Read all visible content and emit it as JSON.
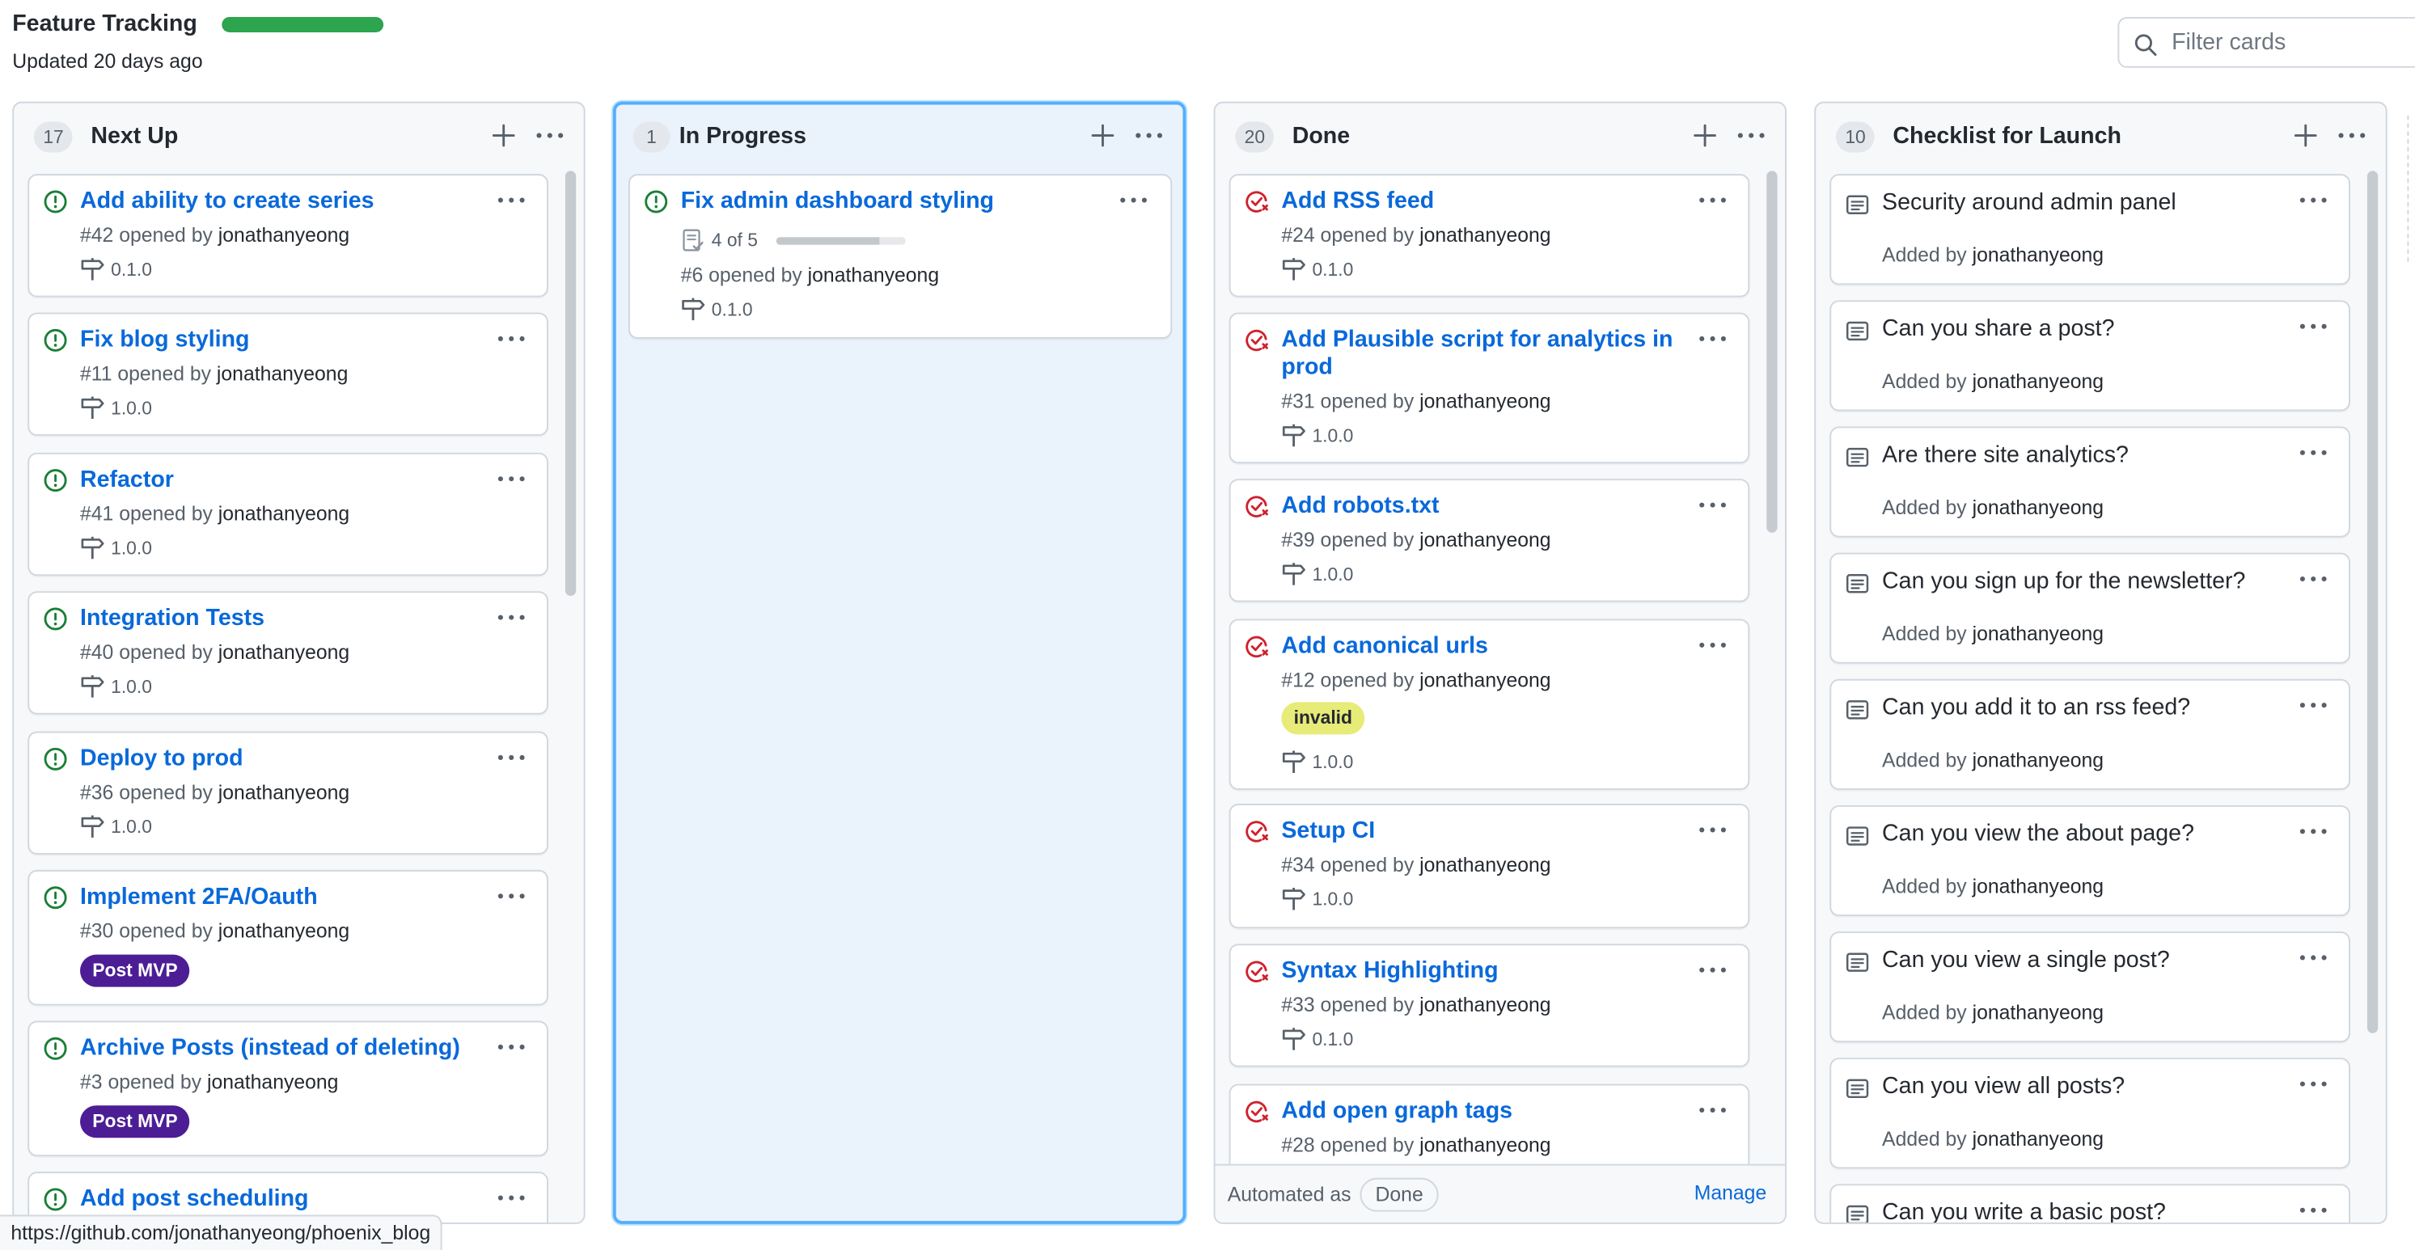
{
  "header": {
    "title": "Feature Tracking",
    "progress": 1.0,
    "updated": "Updated 20 days ago",
    "filter_placeholder": "Filter cards"
  },
  "colors": {
    "open_issue": "#1a7f37",
    "closed_issue": "#cf222e",
    "link": "#0969da",
    "progress": "#2da44e"
  },
  "columns": [
    {
      "count": "17",
      "name": "Next Up",
      "cards": [
        {
          "title": "Add ability to create series",
          "meta_prefix": "#42 opened by",
          "author": "jonathanyeong",
          "milestone": "0.1.0",
          "state": "open"
        },
        {
          "title": "Fix blog styling",
          "meta_prefix": "#11 opened by",
          "author": "jonathanyeong",
          "milestone": "1.0.0",
          "state": "open"
        },
        {
          "title": "Refactor",
          "meta_prefix": "#41 opened by",
          "author": "jonathanyeong",
          "milestone": "1.0.0",
          "state": "open"
        },
        {
          "title": "Integration Tests",
          "meta_prefix": "#40 opened by",
          "author": "jonathanyeong",
          "milestone": "1.0.0",
          "state": "open"
        },
        {
          "title": "Deploy to prod",
          "meta_prefix": "#36 opened by",
          "author": "jonathanyeong",
          "milestone": "1.0.0",
          "state": "open"
        },
        {
          "title": "Implement 2FA/Oauth",
          "meta_prefix": "#30 opened by",
          "author": "jonathanyeong",
          "label": "Post MVP",
          "state": "open"
        },
        {
          "title": "Archive Posts (instead of deleting)",
          "meta_prefix": "#3 opened by",
          "author": "jonathanyeong",
          "label": "Post MVP",
          "state": "open"
        },
        {
          "title": "Add post scheduling",
          "state": "open"
        }
      ]
    },
    {
      "count": "1",
      "name": "In Progress",
      "cards": [
        {
          "title": "Fix admin dashboard styling",
          "tasks": "4 of 5",
          "task_progress": 0.8,
          "meta_prefix": "#6 opened by",
          "author": "jonathanyeong",
          "milestone": "0.1.0",
          "state": "open"
        }
      ]
    },
    {
      "count": "20",
      "name": "Done",
      "cards": [
        {
          "title": "Add RSS feed",
          "meta_prefix": "#24 opened by",
          "author": "jonathanyeong",
          "milestone": "0.1.0",
          "state": "closed"
        },
        {
          "title": "Add Plausible script for analytics in prod",
          "meta_prefix": "#31 opened by",
          "author": "jonathanyeong",
          "milestone": "1.0.0",
          "state": "closed"
        },
        {
          "title": "Add robots.txt",
          "meta_prefix": "#39 opened by",
          "author": "jonathanyeong",
          "milestone": "1.0.0",
          "state": "closed"
        },
        {
          "title": "Add canonical urls",
          "meta_prefix": "#12 opened by",
          "author": "jonathanyeong",
          "label": "invalid",
          "milestone": "1.0.0",
          "state": "closed"
        },
        {
          "title": "Setup CI",
          "meta_prefix": "#34 opened by",
          "author": "jonathanyeong",
          "milestone": "1.0.0",
          "state": "closed"
        },
        {
          "title": "Syntax Highlighting",
          "meta_prefix": "#33 opened by",
          "author": "jonathanyeong",
          "milestone": "0.1.0",
          "state": "closed"
        },
        {
          "title": "Add open graph tags",
          "meta_prefix": "#28 opened by",
          "author": "jonathanyeong",
          "state": "closed"
        }
      ],
      "automation": {
        "label": "Automated as",
        "badge": "Done",
        "manage": "Manage"
      }
    },
    {
      "count": "10",
      "name": "Checklist for Launch",
      "notes": [
        {
          "title": "Security around admin panel",
          "meta_prefix": "Added by",
          "author": "jonathanyeong"
        },
        {
          "title": "Can you share a post?",
          "meta_prefix": "Added by",
          "author": "jonathanyeong"
        },
        {
          "title": "Are there site analytics?",
          "meta_prefix": "Added by",
          "author": "jonathanyeong"
        },
        {
          "title": "Can you sign up for the newsletter?",
          "meta_prefix": "Added by",
          "author": "jonathanyeong"
        },
        {
          "title": "Can you add it to an rss feed?",
          "meta_prefix": "Added by",
          "author": "jonathanyeong"
        },
        {
          "title": "Can you view the about page?",
          "meta_prefix": "Added by",
          "author": "jonathanyeong"
        },
        {
          "title": "Can you view a single post?",
          "meta_prefix": "Added by",
          "author": "jonathanyeong"
        },
        {
          "title": "Can you view all posts?",
          "meta_prefix": "Added by",
          "author": "jonathanyeong"
        },
        {
          "title": "Can you write a basic post?"
        }
      ]
    }
  ],
  "status_bar": {
    "url": "https://github.com/jonathanyeong/phoenix_blog"
  }
}
